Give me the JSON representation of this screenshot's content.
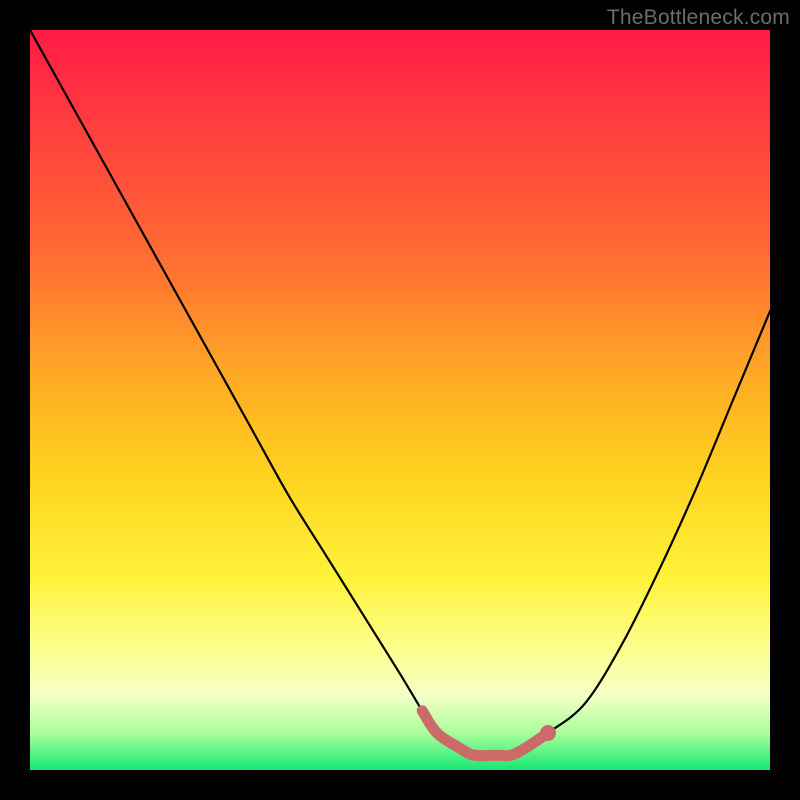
{
  "watermark": "TheBottleneck.com",
  "colors": {
    "frame": "#000000",
    "curve_stroke": "#000000",
    "highlight_stroke": "#cc6a6a",
    "gradient_stops": [
      "#ff1a47",
      "#ff6a33",
      "#ffd21f",
      "#fcff90",
      "#17e874"
    ]
  },
  "chart_data": {
    "type": "line",
    "title": "",
    "xlabel": "",
    "ylabel": "",
    "xlim": [
      0,
      100
    ],
    "ylim": [
      0,
      100
    ],
    "grid": false,
    "legend": false,
    "series": [
      {
        "name": "bottleneck-curve",
        "x": [
          0,
          5,
          10,
          15,
          20,
          25,
          30,
          35,
          40,
          45,
          50,
          53,
          55,
          58,
          60,
          63,
          65,
          67,
          70,
          75,
          80,
          85,
          90,
          95,
          100
        ],
        "y": [
          100,
          91,
          82,
          73,
          64,
          55,
          46,
          37,
          29,
          21,
          13,
          8,
          5,
          3,
          2,
          2,
          2,
          3,
          5,
          9,
          17,
          27,
          38,
          50,
          62
        ]
      }
    ],
    "annotations": [
      {
        "name": "optimal-range",
        "kind": "highlight",
        "x_range": [
          53,
          70
        ],
        "note": "thick pink segment marking the minimum / optimal zone"
      },
      {
        "name": "optimal-end-dot",
        "kind": "point",
        "x": 70,
        "y": 5
      }
    ]
  }
}
